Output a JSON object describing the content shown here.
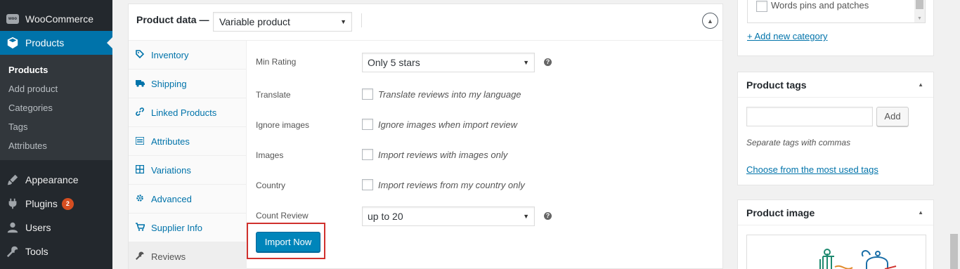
{
  "sidebar": {
    "woocommerce": "WooCommerce",
    "products": "Products",
    "submenu": [
      "Products",
      "Add product",
      "Categories",
      "Tags",
      "Attributes"
    ],
    "appearance": "Appearance",
    "plugins": "Plugins",
    "plugins_badge": "2",
    "users": "Users",
    "tools": "Tools"
  },
  "product_data": {
    "title": "Product data —",
    "type_value": "Variable product",
    "tabs": [
      "Inventory",
      "Shipping",
      "Linked Products",
      "Attributes",
      "Variations",
      "Advanced",
      "Supplier Info",
      "Reviews"
    ],
    "fields": {
      "min_rating": {
        "label": "Min Rating",
        "value": "Only 5 stars"
      },
      "translate": {
        "label": "Translate",
        "text": "Translate reviews into my language"
      },
      "ignore_images": {
        "label": "Ignore images",
        "text": "Ignore images when import review"
      },
      "images": {
        "label": "Images",
        "text": "Import reviews with images only"
      },
      "country": {
        "label": "Country",
        "text": "Import reviews from my country only"
      },
      "count_review": {
        "label": "Count Review",
        "value": "up to 20"
      }
    },
    "import_button": "Import Now"
  },
  "categories": {
    "last_item": "Words pins and patches",
    "add_link": "+ Add new category"
  },
  "tags": {
    "title": "Product tags",
    "add_button": "Add",
    "hint": "Separate tags with commas",
    "choose_link": "Choose from the most used tags"
  },
  "image": {
    "title": "Product image"
  },
  "colors": {
    "sidebar_bg": "#23282d",
    "accent": "#0073aa",
    "primary_button": "#0085ba",
    "highlight_box": "#d0312d"
  }
}
